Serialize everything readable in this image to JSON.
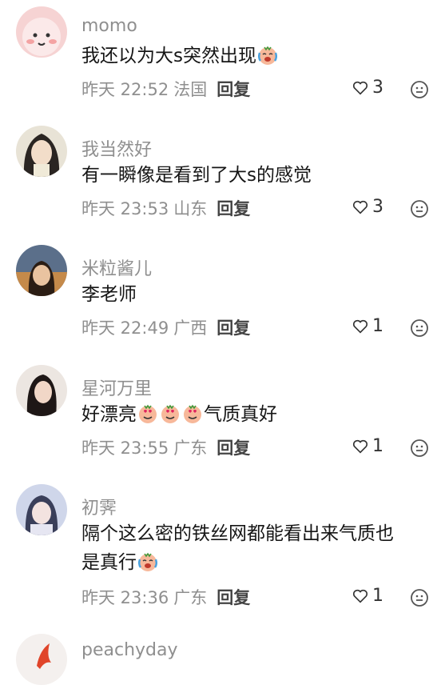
{
  "comments": [
    {
      "user": "momo",
      "text": "我还以为大s突然出现",
      "time": "昨天 22:52",
      "location": "法国",
      "reply": "回复",
      "likes": "3",
      "emoji": "crying-laughing-emoji"
    },
    {
      "user": "我当然好",
      "text": "有一瞬像是看到了大s的感觉",
      "time": "昨天 23:53",
      "location": "山东",
      "reply": "回复",
      "likes": "3"
    },
    {
      "user": "米粒酱儿",
      "text": "李老师",
      "time": "昨天 22:49",
      "location": "广西",
      "reply": "回复",
      "likes": "1"
    },
    {
      "user": "星河万里",
      "text_before": "好漂亮",
      "text_after": "气质真好",
      "time": "昨天 23:55",
      "location": "广东",
      "reply": "回复",
      "likes": "1",
      "emoji": "heart-eyes-emoji"
    },
    {
      "user": "初霁",
      "text_line1": "隔个这么密的铁丝网都能看出来气质也",
      "text_line2": "是真行",
      "time": "昨天 23:36",
      "location": "广东",
      "reply": "回复",
      "likes": "1",
      "emoji": "crying-laughing-emoji"
    },
    {
      "user": "peachyday"
    }
  ],
  "colors": {
    "secondary_text": "#8f8f8f",
    "primary_text": "#161616"
  }
}
